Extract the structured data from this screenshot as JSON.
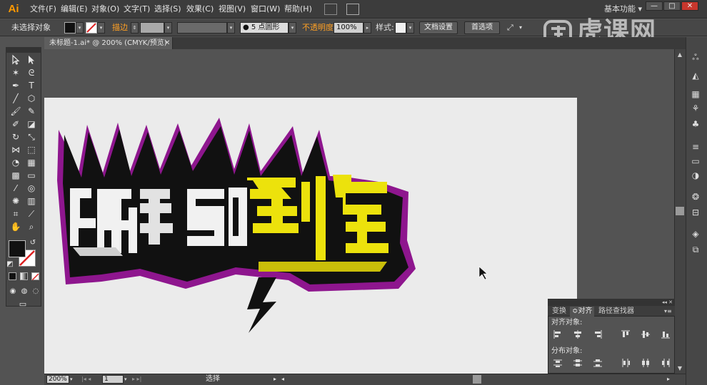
{
  "app": {
    "logo_text": "Ai"
  },
  "menu": {
    "items": [
      "文件(F)",
      "编辑(E)",
      "对象(O)",
      "文字(T)",
      "选择(S)",
      "效果(C)",
      "视图(V)",
      "窗口(W)",
      "帮助(H)"
    ],
    "workspace": "基本功能 ▾"
  },
  "window_buttons": {
    "minimize": "—",
    "restore": "□",
    "close": "✕"
  },
  "control_bar": {
    "selection_status": "未选择对象",
    "stroke_label": "描边",
    "brush_value": "5 点圆形",
    "opacity_label": "不透明度",
    "opacity_value": "100%",
    "style_label": "样式",
    "doc_setup_button": "文档设置",
    "preferences_button": "首选项"
  },
  "watermark": "虎课网",
  "document": {
    "tab_title": "未标题-1.ai* @ 200% (CMYK/预览)",
    "tab_close": "✕"
  },
  "status_bar": {
    "zoom": "200%",
    "artboard": "1",
    "tool": "选择"
  },
  "align_panel": {
    "tabs": [
      "变换",
      "对齐",
      "路径查找器"
    ],
    "active_tab": "对齐",
    "align_objects_label": "对齐对象:",
    "distribute_objects_label": "分布对象:"
  },
  "colors": {
    "accent_orange": "#ffa024",
    "text_yellow": "#ece20c",
    "outline_purple": "#8e168e",
    "artboard": "#ebebeb"
  }
}
